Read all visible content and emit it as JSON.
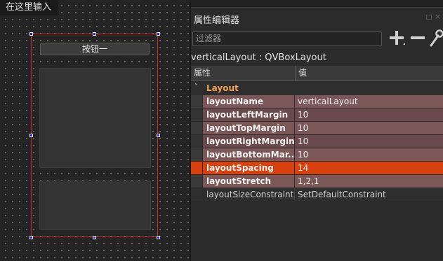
{
  "canvas": {
    "hint_text": "在这里输入",
    "button_label": "按钮一"
  },
  "property_editor": {
    "title": "属性编辑器",
    "filter_placeholder": "过滤器",
    "object_class": "verticalLayout : QVBoxLayout",
    "header": {
      "property": "属性",
      "value": "值"
    },
    "group": {
      "arrow": "˅",
      "label": "Layout"
    },
    "rows": [
      {
        "name": "layoutName",
        "value": "verticalLayout",
        "style": "row-a"
      },
      {
        "name": "layoutLeftMargin",
        "value": "10",
        "style": "row-b"
      },
      {
        "name": "layoutTopMargin",
        "value": "10",
        "style": "row-a"
      },
      {
        "name": "layoutRightMargin",
        "value": "10",
        "style": "row-b"
      },
      {
        "name": "layoutBottomMar...",
        "value": "10",
        "style": "row-a"
      },
      {
        "name": "layoutSpacing",
        "value": "14",
        "style": "row-sel"
      },
      {
        "name": "layoutStretch",
        "value": "1,2,1",
        "style": "row-a"
      },
      {
        "name": "layoutSizeConstraint",
        "value": "SetDefaultConstraint",
        "style": "row-plain"
      }
    ],
    "icons": {
      "add": "plus-icon",
      "remove": "minus-icon",
      "configure": "wrench-icon",
      "float": "dock-float-icon",
      "close": "dock-close-icon"
    }
  },
  "colors": {
    "selection_border": "#cc2a2a",
    "handle": "#1a1aff",
    "group_label": "#f0a050",
    "selected_row": "#d8410e",
    "row_light": "#7b5757",
    "row_dark": "#6a4a4a"
  }
}
